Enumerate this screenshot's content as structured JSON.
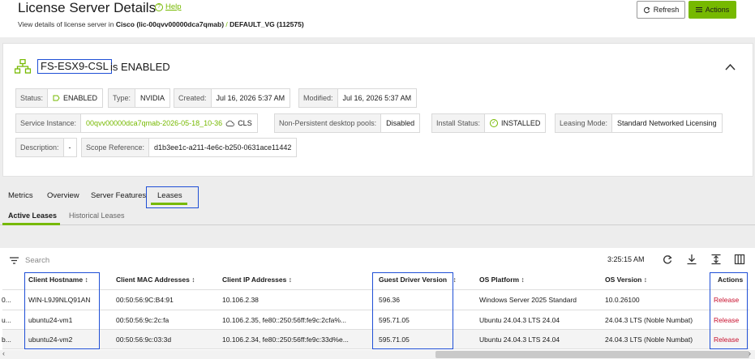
{
  "header": {
    "title": "License Server Details",
    "help": "Help",
    "subtitle_prefix": "View details of license server in",
    "org": "Cisco (lic-00qvv00000dca7qmab)",
    "separator": "/",
    "vg": "DEFAULT_VG (112575)",
    "refresh_label": "Refresh",
    "actions_label": "Actions"
  },
  "server": {
    "name": "FS-ESX9-CSL",
    "status_text": "is ENABLED"
  },
  "details": {
    "status_k": "Status:",
    "status_v": "ENABLED",
    "type_k": "Type:",
    "type_v": "NVIDIA",
    "created_k": "Created:",
    "created_v": "Jul 16, 2026 5:37 AM",
    "modified_k": "Modified:",
    "modified_v": "Jul 16, 2026 5:37 AM",
    "instance_k": "Service Instance:",
    "instance_v": "00qvv00000dca7qmab-2026-05-18_10-36",
    "instance_tag": "CLS",
    "pools_k": "Non-Persistent desktop pools:",
    "pools_v": "Disabled",
    "install_k": "Install Status:",
    "install_v": "INSTALLED",
    "leasing_k": "Leasing Mode:",
    "leasing_v": "Standard Networked Licensing",
    "desc_k": "Description:",
    "desc_v": "-",
    "scope_k": "Scope Reference:",
    "scope_v": "d1b3ee1c-a211-4e6c-b250-0631ace11442"
  },
  "tabs": [
    "Metrics",
    "Overview",
    "Server Features",
    "Leases"
  ],
  "subtabs": [
    "Active Leases",
    "Historical Leases"
  ],
  "toolbar": {
    "search_placeholder": "Search",
    "time": "3:25:15 AM"
  },
  "table": {
    "headers": [
      "Client Hostname",
      "Client MAC Addresses",
      "Client IP Addresses",
      "Guest Driver Version",
      "OS Platform",
      "OS Version",
      "Actions"
    ],
    "rows": [
      {
        "lead": "0...",
        "host": "WIN-L9J9NLQ91AN",
        "mac": "00:50:56:9C:B4:91",
        "ip": "10.106.2.38",
        "driver": "596.36",
        "os": "Windows Server 2025 Standard",
        "ver": "10.0.26100",
        "action": "Release"
      },
      {
        "lead": "u...",
        "host": "ubuntu24-vm1",
        "mac": "00:50:56:9c:2c:fa",
        "ip": "10.106.2.35, fe80::250:56ff:fe9c:2cfa%...",
        "driver": "595.71.05",
        "os": "Ubuntu 24.04.3 LTS 24.04",
        "ver": "24.04.3 LTS (Noble Numbat)",
        "action": "Release"
      },
      {
        "lead": "b...",
        "host": "ubuntu24-vm2",
        "mac": "00:50:56:9c:03:3d",
        "ip": "10.106.2.34, fe80::250:56ff:fe9c:33d%e...",
        "driver": "595.71.05",
        "os": "Ubuntu 24.04.3 LTS 24.04",
        "ver": "24.04.3 LTS (Noble Numbat)",
        "action": "Release"
      }
    ]
  },
  "colors": {
    "accent": "#76b900",
    "highlight": "#1f4fd6",
    "danger": "#c8102e"
  }
}
